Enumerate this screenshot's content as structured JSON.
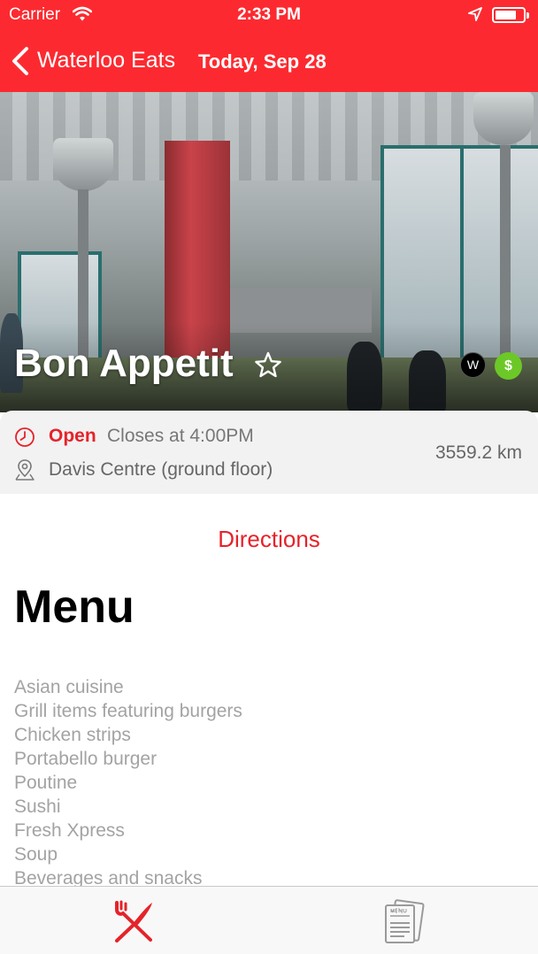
{
  "status_bar": {
    "carrier": "Carrier",
    "time": "2:33 PM",
    "battery_level": 0.75
  },
  "nav": {
    "back_label": "Waterloo Eats",
    "title": "Today, Sep 28"
  },
  "restaurant": {
    "name": "Bon Appetit",
    "badges": [
      {
        "icon": "watcard-badge",
        "text": "W"
      },
      {
        "icon": "dollar-badge",
        "text": "$"
      }
    ],
    "status": "Open",
    "hours": "Closes at 4:00PM",
    "location": "Davis Centre (ground floor)",
    "distance": "3559.2 km"
  },
  "directions_label": "Directions",
  "menu": {
    "heading": "Menu",
    "items": [
      "Asian cuisine",
      "Grill items featuring burgers",
      "Chicken strips",
      "Portabello burger",
      "Poutine",
      "Sushi",
      "Fresh Xpress",
      "Soup",
      "Beverages and snacks"
    ]
  },
  "tabs": [
    {
      "icon": "fork-knife-icon",
      "selected": true
    },
    {
      "icon": "menu-icon",
      "selected": false
    }
  ],
  "colors": {
    "accent": "#fc2a30",
    "open": "#e5232a",
    "muted_text": "#a3a3a3",
    "card_bg": "#f2f2f2",
    "dollar_badge": "#6cc827"
  }
}
